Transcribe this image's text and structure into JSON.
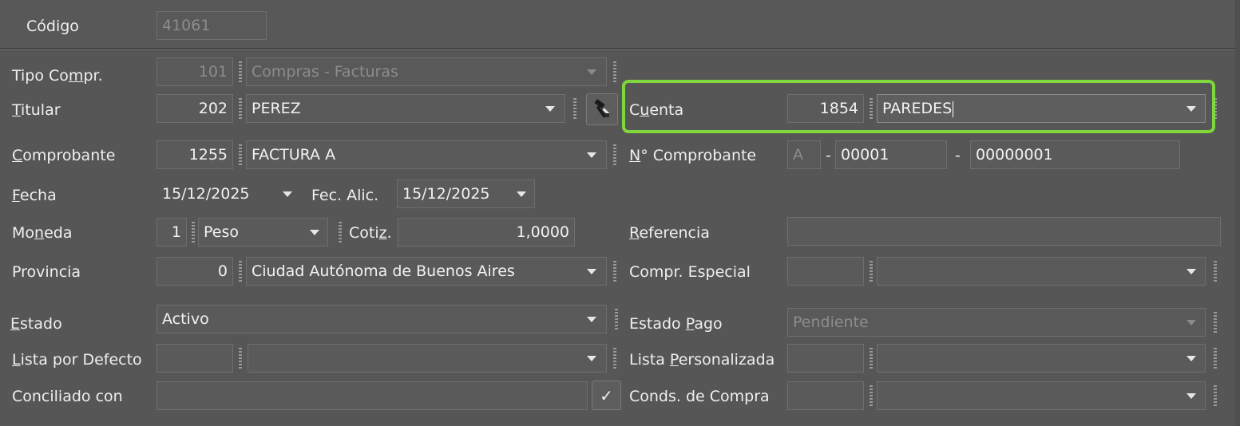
{
  "header": {
    "codigo_label": "Código",
    "codigo_value": "41061"
  },
  "tipo_compr": {
    "label_a": "Tipo Co",
    "label_u": "m",
    "label_b": "pr.",
    "code": "101",
    "name": "Compras - Facturas"
  },
  "titular": {
    "label_u": "T",
    "label_b": "itular",
    "code": "202",
    "name": "PEREZ"
  },
  "cuenta": {
    "label_a": "C",
    "label_u": "u",
    "label_b": "enta",
    "code": "1854",
    "name": "PAREDES"
  },
  "comprobante": {
    "label_u": "C",
    "label_b": "omprobante",
    "code": "1255",
    "name": "FACTURA A"
  },
  "nro_comprobante": {
    "label_u": "N",
    "label_b": "° Comprobante",
    "letter": "A",
    "sep1": "-",
    "punto": "00001",
    "sep2": "-",
    "numero": "00000001"
  },
  "fecha": {
    "label_u": "F",
    "label_b": "echa",
    "value": "15/12/2025"
  },
  "fec_alic": {
    "label": "Fec. Alic.",
    "value": "15/12/2025"
  },
  "moneda": {
    "label_a": "Mo",
    "label_u": "n",
    "label_b": "eda",
    "code": "1",
    "name": "Peso"
  },
  "cotiz": {
    "label_a": "Coti",
    "label_u": "z",
    "label_b": ".",
    "value": "1,0000"
  },
  "referencia": {
    "label_u": "R",
    "label_b": "eferencia",
    "value": ""
  },
  "provincia": {
    "label": "Provincia",
    "code": "0",
    "name": "Ciudad Autónoma de Buenos Aires"
  },
  "compr_especial": {
    "label": "Compr. Especial",
    "code": "",
    "name": ""
  },
  "estado": {
    "label_u": "E",
    "label_b": "stado",
    "value": "Activo"
  },
  "estado_pago": {
    "label_a": "Estado ",
    "label_u": "P",
    "label_b": "ago",
    "value": "Pendiente"
  },
  "lista_defecto": {
    "label_u": "L",
    "label_b": "ista por Defecto",
    "code": "",
    "name": ""
  },
  "lista_personalizada": {
    "label_a": "Lista ",
    "label_u": "P",
    "label_b": "ersonalizada",
    "code": "",
    "name": ""
  },
  "conciliado": {
    "label": "Conciliado con",
    "value": "",
    "check_glyph": "✓"
  },
  "conds_compra": {
    "label": "Conds. de Compra",
    "code": "",
    "name": ""
  },
  "icons": {
    "titular_lookup": "hammer-tool-icon",
    "check": "check-icon",
    "dropdown": "chevron-down-icon"
  },
  "colors": {
    "highlight": "#7fd63d",
    "background": "#565656"
  }
}
